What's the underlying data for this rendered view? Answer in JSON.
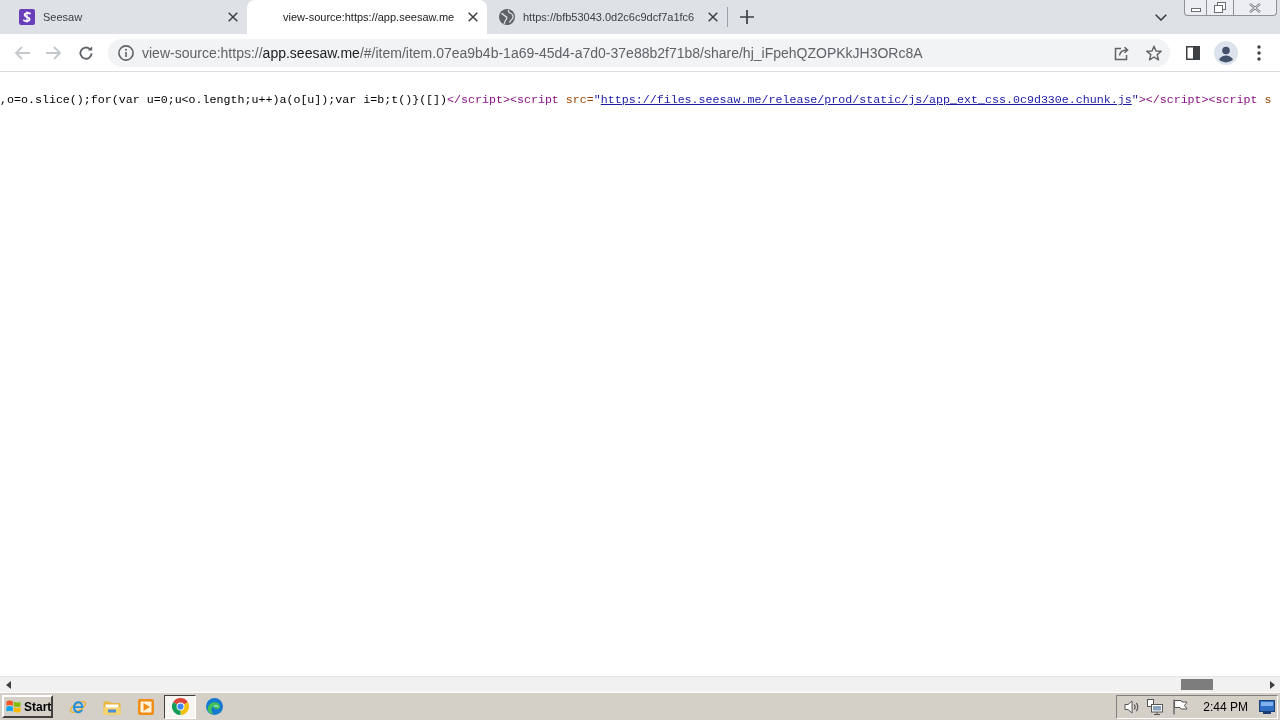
{
  "browser": {
    "tabs": [
      {
        "kind": "seesaw",
        "title": "Seesaw",
        "selected": false
      },
      {
        "kind": "none",
        "title": "view-source:https://app.seesaw.me",
        "selected": true
      },
      {
        "kind": "globe",
        "title": "https://bfb53043.0d2c6c9dcf7a1fc6",
        "selected": false
      }
    ],
    "navigation": {
      "back": {
        "disabled": true
      },
      "forward": {
        "disabled": true
      }
    },
    "address_bar": {
      "url": [
        {
          "text": "view-source:https://",
          "emphasis": false
        },
        {
          "text": "app.seesaw.me",
          "emphasis": true
        },
        {
          "text": "/#/item/item.07ea9b4b-1a69-45d4-a7d0-37e88b2f71b8/share/hj_iFpehQZOPKkJH3ORc8A",
          "emphasis": false
        }
      ]
    }
  },
  "source_view": {
    "tokens": [
      {
        "kind": "text",
        "text": ",o=o.slice();for(var u=0;u<o.length;u++)a(o[u]);var i=b;t()}([])"
      },
      {
        "kind": "tag",
        "text": "</script>"
      },
      {
        "kind": "tag",
        "text": "<script"
      },
      {
        "kind": "attribute",
        "text": " src="
      },
      {
        "kind": "value",
        "text": "\""
      },
      {
        "kind": "link",
        "text": "https://files.seesaw.me/release/prod/static/js/app_ext_css.0c9d330e.chunk.js"
      },
      {
        "kind": "value",
        "text": "\""
      },
      {
        "kind": "tag",
        "text": ">"
      },
      {
        "kind": "tag",
        "text": "</script>"
      },
      {
        "kind": "tag",
        "text": "<script"
      },
      {
        "kind": "attribute",
        "text": " s"
      }
    ]
  },
  "taskbar": {
    "start_label": "Start",
    "apps": [
      {
        "kind": "internet_explorer",
        "active": false
      },
      {
        "kind": "explorer",
        "active": false
      },
      {
        "kind": "media_player",
        "active": false
      },
      {
        "kind": "chrome",
        "active": true
      },
      {
        "kind": "edge",
        "active": false
      }
    ],
    "clock": "2:44 PM"
  }
}
